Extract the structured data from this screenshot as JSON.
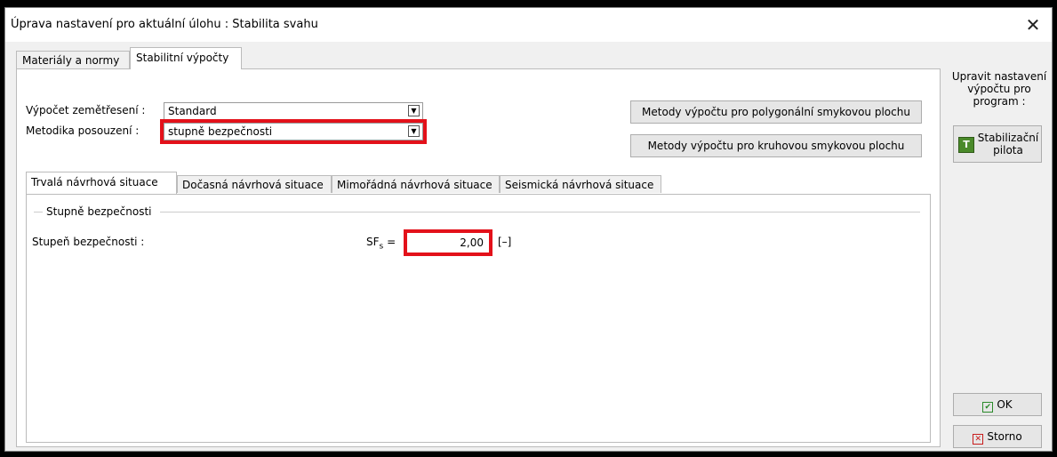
{
  "window": {
    "title": "Úprava nastavení pro aktuální úlohu : Stabilita svahu",
    "close_glyph": "✕"
  },
  "outer_tabs": [
    {
      "label": "Materiály a normy",
      "active": false
    },
    {
      "label": "Stabilitní výpočty",
      "active": true
    }
  ],
  "form": {
    "earthquake_label": "Výpočet zemětřesení :",
    "earthquake_value": "Standard",
    "method_label": "Metodika posouzení :",
    "method_value": "stupně bezpečnosti"
  },
  "buttons": {
    "polygonal": "Metody výpočtu pro polygonální smykovou plochu",
    "circular": "Metody výpočtu pro kruhovou smykovou plochu"
  },
  "inner_tabs": [
    {
      "label": "Trvalá návrhová situace",
      "active": true
    },
    {
      "label": "Dočasná návrhová situace",
      "active": false
    },
    {
      "label": "Mimořádná návrhová situace",
      "active": false
    },
    {
      "label": "Seismická návrhová situace",
      "active": false
    }
  ],
  "safety": {
    "group_title": "Stupně bezpečnosti",
    "row_label": "Stupeň bezpečnosti :",
    "symbol": "SF",
    "symbol_sub": "s",
    "equals": "=",
    "value": "2,00",
    "unit": "[–]"
  },
  "side": {
    "line1": "Upravit nastavení",
    "line2": "výpočtu pro",
    "line3": "program :",
    "pile_label_line1": "Stabilizační",
    "pile_label_line2": "pilota",
    "pile_icon": "pile-icon",
    "ok_label": "OK",
    "cancel_label": "Storno"
  },
  "colors": {
    "highlight": "#e3111a",
    "ok_icon": "#2a8a2a",
    "cancel_icon": "#c81c1c",
    "pile_icon": "#4a8a2a"
  }
}
